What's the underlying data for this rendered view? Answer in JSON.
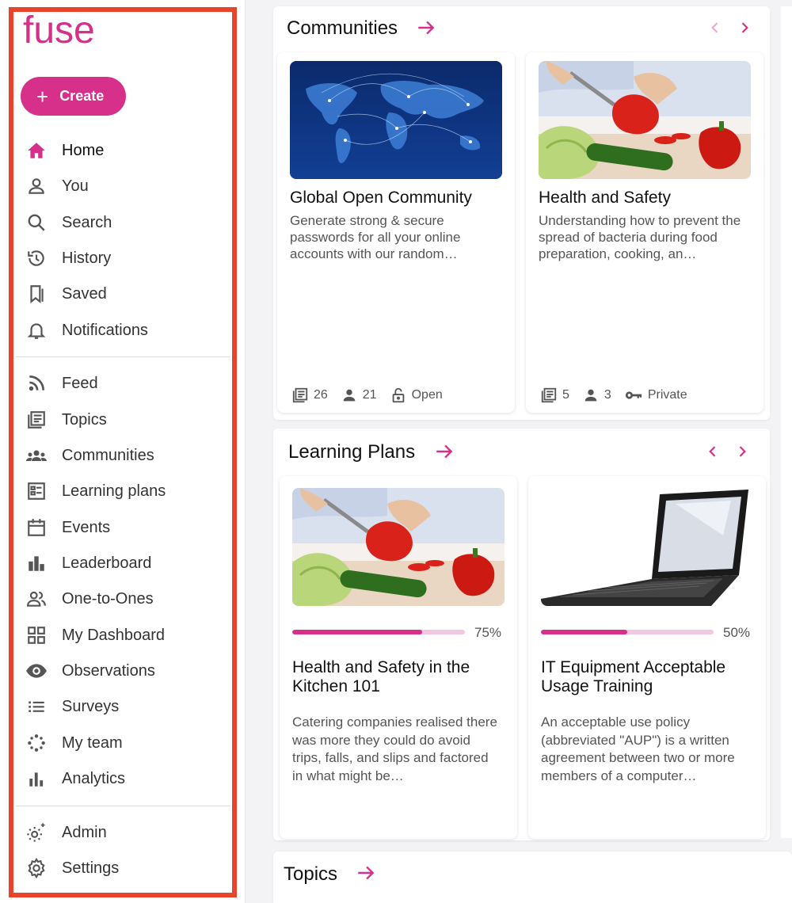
{
  "brand": {
    "logo_text": "fuse",
    "accent": "#d6308a"
  },
  "create_label": "Create",
  "nav": {
    "home": "Home",
    "you": "You",
    "search": "Search",
    "history": "History",
    "saved": "Saved",
    "notifications": "Notifications",
    "feed": "Feed",
    "topics": "Topics",
    "communities": "Communities",
    "learning_plans": "Learning plans",
    "events": "Events",
    "leaderboard": "Leaderboard",
    "one_to_ones": "One-to-Ones",
    "my_dashboard": "My Dashboard",
    "observations": "Observations",
    "surveys": "Surveys",
    "my_team": "My team",
    "analytics": "Analytics",
    "admin": "Admin",
    "settings": "Settings"
  },
  "communities": {
    "title": "Communities",
    "cards": [
      {
        "title": "Global Open Community",
        "description": "Generate strong & secure passwords for all your online accounts with our random…",
        "topics": "26",
        "members": "21",
        "access": "Open",
        "image": "world-map-network"
      },
      {
        "title": "Health and Safety",
        "description": "Understanding how to prevent the spread of bacteria during food preparation, cooking, an…",
        "topics": "5",
        "members": "3",
        "access": "Private",
        "image": "chopping-peppers"
      }
    ]
  },
  "learning_plans": {
    "title": "Learning Plans",
    "cards": [
      {
        "title": "Health and Safety in the Kitchen 101",
        "progress": 75,
        "progress_label": "75%",
        "description": "Catering companies realised there was more they could do avoid trips, falls, and slips and factored in what might be…",
        "image": "chopping-peppers"
      },
      {
        "title": "IT Equipment Acceptable Usage Training",
        "progress": 50,
        "progress_label": "50%",
        "description": "An acceptable use policy (abbreviated \"AUP\") is a written agreement between two or more members of a computer…",
        "image": "laptop"
      }
    ]
  },
  "topics": {
    "title": "Topics"
  }
}
